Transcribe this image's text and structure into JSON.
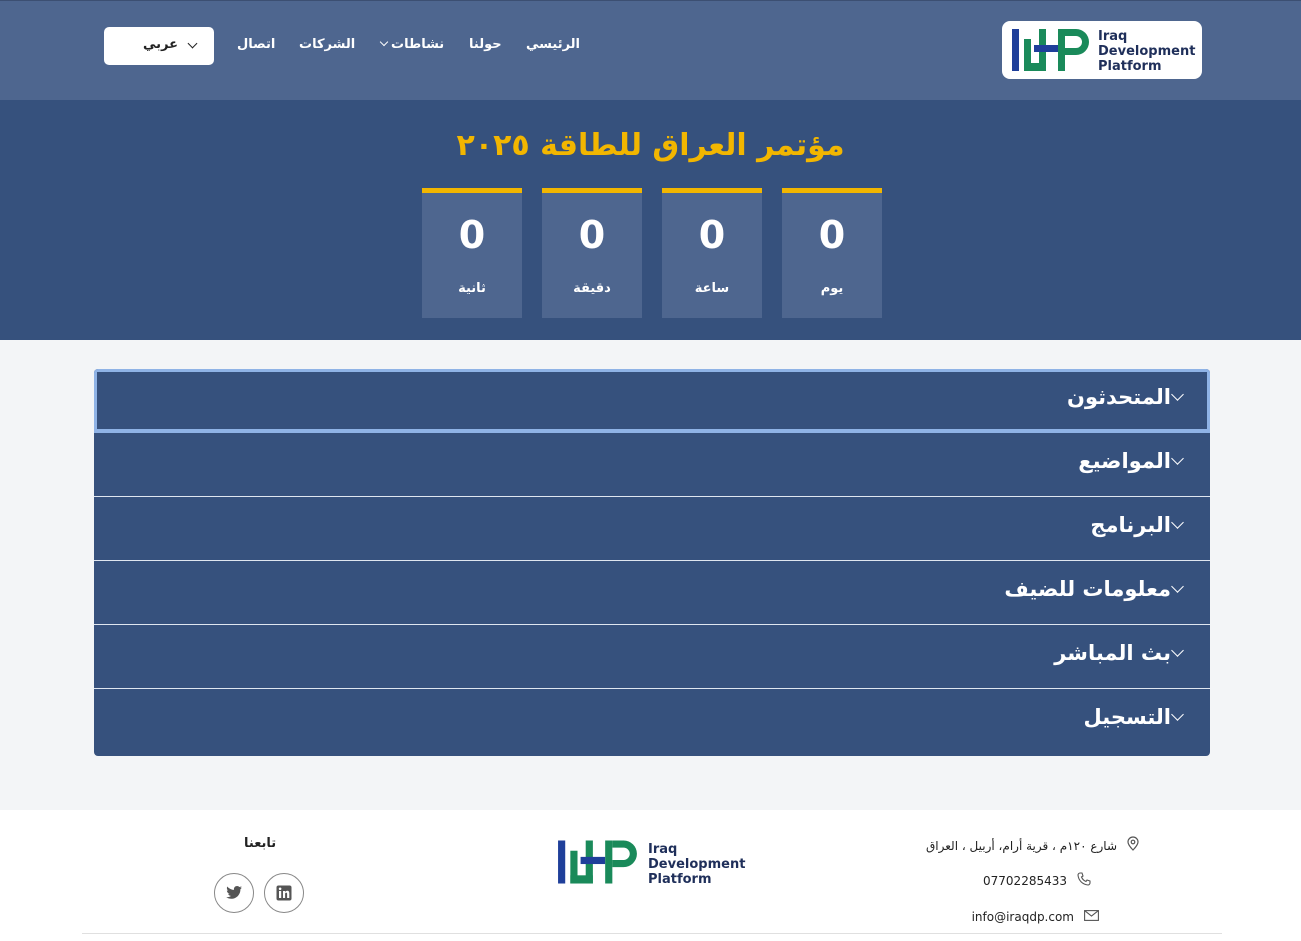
{
  "header": {
    "logo": {
      "text_line1": "Iraq",
      "text_line2": "Development",
      "text_line3": "Platform"
    },
    "nav": {
      "home": "الرئيسي",
      "about": "حولنا",
      "activities": "نشاطات",
      "companies": "الشركات",
      "contact": "اتصال"
    },
    "language": {
      "selected": "عربي"
    }
  },
  "hero": {
    "title": "مؤتمر العراق للطاقة ٢٠٢٥",
    "countdown": [
      {
        "value": "0",
        "unit": "يوم"
      },
      {
        "value": "0",
        "unit": "ساعة"
      },
      {
        "value": "0",
        "unit": "دقيقة"
      },
      {
        "value": "0",
        "unit": "ثانية"
      }
    ]
  },
  "accordion": {
    "items": [
      "المتحدثون",
      "المواضيع",
      "البرنامج",
      "معلومات للضيف",
      "بث المباشر",
      "التسجيل"
    ]
  },
  "footer": {
    "address": "شارع ١٢٠م ، قرية أرام، أربيل ، العراق",
    "phone": "07702285433",
    "email": "info@iraqdp.com",
    "follow_title": "تابعنا"
  },
  "colors": {
    "header_bg": "#4e668f",
    "hero_bg": "#36517d",
    "accent": "#f2b600",
    "logo_blue": "#1f3f9a",
    "logo_green": "#1a8a5a"
  }
}
